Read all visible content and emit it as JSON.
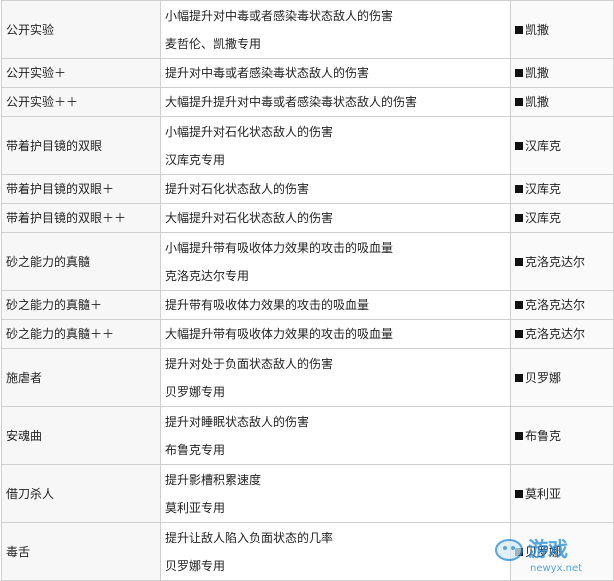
{
  "rows": [
    {
      "name": "公开实验",
      "desc1": "小幅提升对中毒或者感染毒状态敌人的伤害",
      "desc2": "麦哲伦、凯撒专用",
      "character": "凯撒"
    },
    {
      "name": "公开实验＋",
      "desc1": "提升对中毒或者感染毒状态敌人的伤害",
      "desc2": "",
      "character": "凯撒"
    },
    {
      "name": "公开实验＋＋",
      "desc1": "大幅提升提升对中毒或者感染毒状态敌人的伤害",
      "desc2": "",
      "character": "凯撒"
    },
    {
      "name": "带着护目镜的双眼",
      "desc1": "小幅提升对石化状态敌人的伤害",
      "desc2": "汉库克专用",
      "character": "汉库克"
    },
    {
      "name": "带着护目镜的双眼＋",
      "desc1": "提升对石化状态敌人的伤害",
      "desc2": "",
      "character": "汉库克"
    },
    {
      "name": "带着护目镜的双眼＋＋",
      "desc1": "大幅提升对石化状态敌人的伤害",
      "desc2": "",
      "character": "汉库克"
    },
    {
      "name": "砂之能力的真髓",
      "desc1": "小幅提升带有吸收体力效果的攻击的吸血量",
      "desc2": "克洛克达尔专用",
      "character": "克洛克达尔"
    },
    {
      "name": "砂之能力的真髓＋",
      "desc1": "提升带有吸收体力效果的攻击的吸血量",
      "desc2": "",
      "character": "克洛克达尔"
    },
    {
      "name": "砂之能力的真髓＋＋",
      "desc1": "大幅提升带有吸收体力效果的攻击的吸血量",
      "desc2": "",
      "character": "克洛克达尔"
    },
    {
      "name": "施虐者",
      "desc1": "提升对处于负面状态敌人的伤害",
      "desc2": "贝罗娜专用",
      "character": "贝罗娜"
    },
    {
      "name": "安魂曲",
      "desc1": "提升对睡眠状态敌人的伤害",
      "desc2": "布鲁克专用",
      "character": "布鲁克"
    },
    {
      "name": "借刀杀人",
      "desc1": "提升影槽积累速度",
      "desc2": "莫利亚专用",
      "character": "莫利亚"
    },
    {
      "name": "毒舌",
      "desc1": "提升让敌人陷入负面状态的几率",
      "desc2": "贝罗娜专用",
      "character": "贝罗娜"
    }
  ],
  "watermark": {
    "brand": "游戏",
    "domain": "newyx.net"
  }
}
